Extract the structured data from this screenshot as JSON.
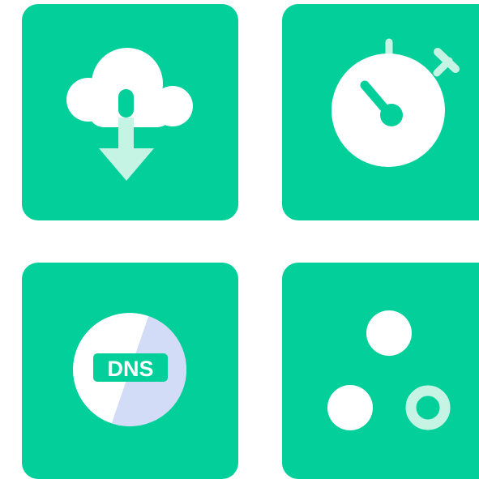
{
  "colors": {
    "accent": "#02cf9a",
    "icon_primary": "#ffffff",
    "icon_secondary": "#c5f4e4",
    "dns_slice": "#d3dcf7"
  },
  "tiles": [
    {
      "icon": "cloud-download-icon"
    },
    {
      "icon": "stopwatch-icon"
    },
    {
      "icon": "dns-icon",
      "label": "DNS"
    },
    {
      "icon": "network-nodes-icon"
    }
  ]
}
